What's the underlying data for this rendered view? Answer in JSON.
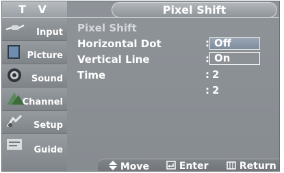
{
  "header": {
    "tv_label": "T V",
    "title": "Pixel Shift"
  },
  "sidebar": {
    "items": [
      {
        "label": "Input",
        "icon": "input-plug-icon"
      },
      {
        "label": "Picture",
        "icon": "picture-icon"
      },
      {
        "label": "Sound",
        "icon": "speaker-icon"
      },
      {
        "label": "Channel",
        "icon": "channel-icon"
      },
      {
        "label": "Setup",
        "icon": "setup-icon"
      },
      {
        "label": "Guide",
        "icon": "guide-icon"
      }
    ]
  },
  "options": [
    {
      "label": "Pixel Shift",
      "colon": ":",
      "value": ""
    },
    {
      "label": "Horizontal Dot",
      "colon": ":",
      "value": ""
    },
    {
      "label": "Vertical Line",
      "colon": ":",
      "value": "2"
    },
    {
      "label": "Time",
      "colon": ":",
      "value": "2"
    }
  ],
  "dropdown": {
    "highlighted": "Off",
    "other": "On"
  },
  "bottom_bar": {
    "move": "Move",
    "enter": "Enter",
    "return": "Return"
  }
}
